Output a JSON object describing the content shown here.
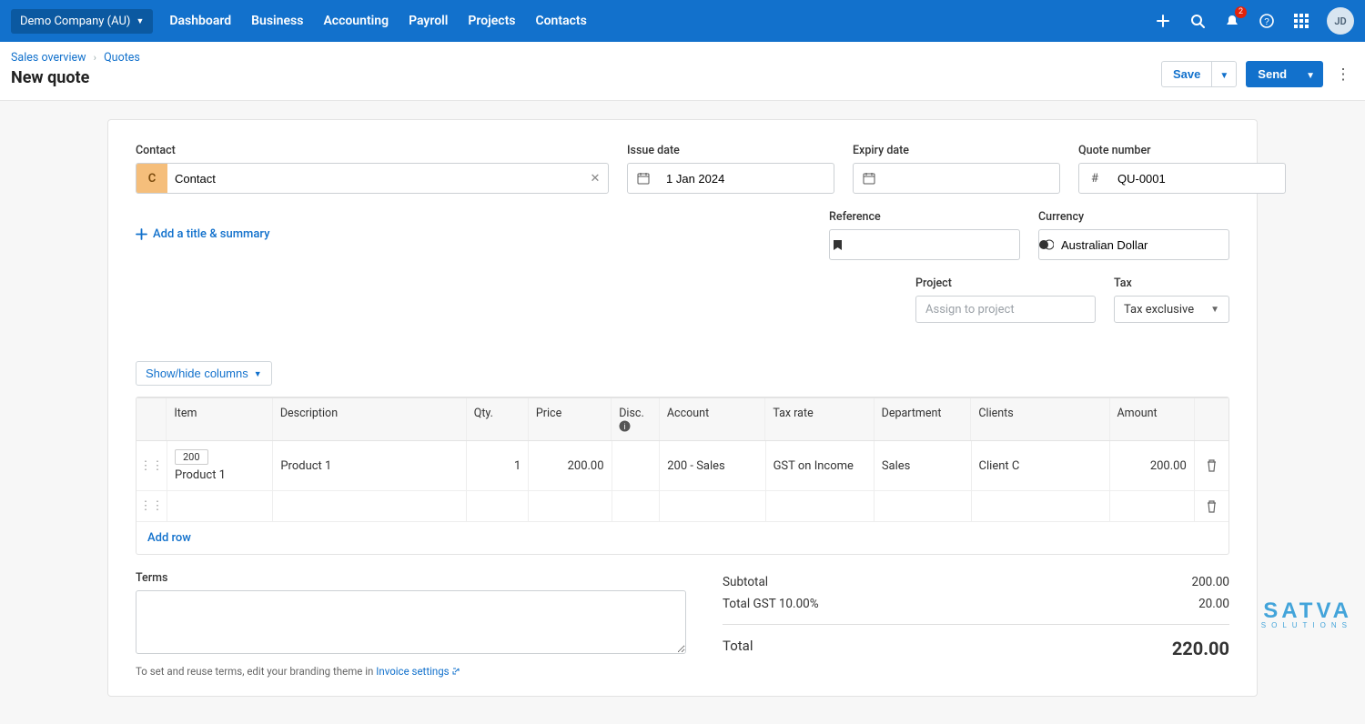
{
  "org": {
    "name": "Demo Company (AU)"
  },
  "nav": {
    "dashboard": "Dashboard",
    "business": "Business",
    "accounting": "Accounting",
    "payroll": "Payroll",
    "projects": "Projects",
    "contacts": "Contacts"
  },
  "notifications": {
    "count": "2"
  },
  "user": {
    "initials": "JD"
  },
  "breadcrumb": {
    "sales_overview": "Sales overview",
    "quotes": "Quotes"
  },
  "page": {
    "title": "New quote"
  },
  "actions": {
    "save": "Save",
    "send": "Send"
  },
  "form": {
    "contact": {
      "label": "Contact",
      "initial": "C",
      "value": "Contact"
    },
    "issue_date": {
      "label": "Issue date",
      "value": "1 Jan 2024"
    },
    "expiry_date": {
      "label": "Expiry date",
      "value": ""
    },
    "quote_number": {
      "label": "Quote number",
      "value": "QU-0001"
    },
    "reference": {
      "label": "Reference",
      "value": ""
    },
    "currency": {
      "label": "Currency",
      "value": "Australian Dollar"
    },
    "project": {
      "label": "Project",
      "placeholder": "Assign to project"
    },
    "tax": {
      "label": "Tax",
      "value": "Tax exclusive"
    },
    "add_title": "Add a title & summary",
    "showhide": "Show/hide columns"
  },
  "table": {
    "headers": {
      "item": "Item",
      "desc": "Description",
      "qty": "Qty.",
      "price": "Price",
      "disc": "Disc.",
      "acct": "Account",
      "tax": "Tax rate",
      "dept": "Department",
      "clients": "Clients",
      "amount": "Amount"
    },
    "rows": [
      {
        "item_code": "200",
        "item_name": "Product 1",
        "desc": "Product 1",
        "qty": "1",
        "price": "200.00",
        "disc": "",
        "acct": "200 - Sales",
        "tax": "GST on Income",
        "dept": "Sales",
        "clients": "Client C",
        "amount": "200.00"
      }
    ],
    "add_row": "Add row"
  },
  "terms": {
    "label": "Terms",
    "hint_prefix": "To set and reuse terms, edit your branding theme in ",
    "hint_link": "Invoice settings"
  },
  "totals": {
    "subtotal_label": "Subtotal",
    "subtotal_value": "200.00",
    "gst_label": "Total GST 10.00%",
    "gst_value": "20.00",
    "total_label": "Total",
    "total_value": "220.00"
  },
  "watermark": {
    "brand": "SATVA",
    "tag": "SOLUTIONS"
  }
}
